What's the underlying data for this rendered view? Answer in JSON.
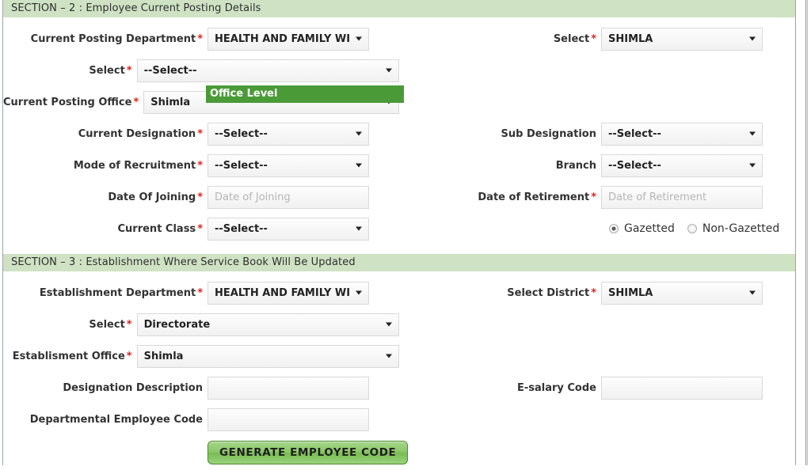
{
  "sections": [
    {
      "id": "section-2",
      "header": "SECTION – 2 : Employee Current Posting Details",
      "rows": [
        {
          "left": {
            "label": "Current Posting Department",
            "required": true,
            "type": "select",
            "value": "HEALTH AND FAMILY WI",
            "width": "narrow"
          },
          "right": {
            "label": "Select",
            "required": true,
            "type": "select",
            "value": "SHIMLA",
            "width": "narrow"
          }
        },
        {
          "left": {
            "label": "Select",
            "required": true,
            "type": "select",
            "value": "--Select--",
            "width": "wide"
          },
          "right": null
        },
        {
          "left": {
            "label": "Current Posting Office",
            "required": true,
            "type": "select",
            "value": "Shimla",
            "width": "wide"
          },
          "right": null
        },
        {
          "left": {
            "label": "Current Designation",
            "required": true,
            "type": "select",
            "value": "--Select--",
            "width": "narrow"
          },
          "right": {
            "label": "Sub Designation",
            "required": false,
            "type": "select",
            "value": "--Select--",
            "width": "narrow"
          }
        },
        {
          "left": {
            "label": "Mode of Recruitment",
            "required": true,
            "type": "select",
            "value": "--Select--",
            "width": "narrow"
          },
          "right": {
            "label": "Branch",
            "required": false,
            "type": "select",
            "value": "--Select--",
            "width": "narrow"
          }
        },
        {
          "left": {
            "label": "Date Of Joining",
            "required": true,
            "type": "text",
            "value": "",
            "placeholder": "Date of Joining",
            "width": "narrow"
          },
          "right": {
            "label": "Date of Retirement",
            "required": true,
            "type": "text",
            "value": "",
            "placeholder": "Date of Retirement",
            "width": "narrow"
          }
        },
        {
          "left": {
            "label": "Current Class",
            "required": true,
            "type": "select",
            "value": "--Select--",
            "width": "narrow"
          },
          "right": {
            "label": "",
            "required": false,
            "type": "radio"
          }
        }
      ]
    },
    {
      "id": "section-3",
      "header": "SECTION – 3 : Establishment Where Service Book Will Be Updated",
      "rows": [
        {
          "left": {
            "label": "Establishment Department",
            "required": true,
            "type": "select",
            "value": "HEALTH AND FAMILY WI",
            "width": "narrow"
          },
          "right": {
            "label": "Select District",
            "required": true,
            "type": "select",
            "value": "SHIMLA",
            "width": "narrow"
          }
        },
        {
          "left": {
            "label": "Select",
            "required": true,
            "type": "select",
            "value": "Directorate",
            "width": "wide"
          },
          "right": null
        },
        {
          "left": {
            "label": "Establisment Office",
            "required": true,
            "type": "select",
            "value": "Shimla",
            "width": "wide"
          },
          "right": null
        },
        {
          "left": {
            "label": "Designation Description",
            "required": false,
            "type": "text",
            "value": "",
            "placeholder": "",
            "width": "narrow"
          },
          "right": {
            "label": "E-salary Code",
            "required": false,
            "type": "text",
            "value": "",
            "placeholder": "",
            "width": "narrow"
          }
        },
        {
          "left": {
            "label": "Departmental Employee Code",
            "required": false,
            "type": "text",
            "value": "",
            "placeholder": "",
            "width": "narrow"
          },
          "right": null
        }
      ]
    }
  ],
  "radio_group": {
    "options": [
      {
        "label": "Gazetted",
        "checked": true
      },
      {
        "label": "Non-Gazetted",
        "checked": false
      }
    ]
  },
  "generate_button": {
    "label": "GENERATE EMPLOYEE CODE"
  },
  "open_dropdown": {
    "highlighted_option": "Office Level"
  },
  "colors": {
    "section_header_bg": "#cfe3c4",
    "dropdown_highlight": "#4a9b38",
    "required_star": "#e2231a",
    "button_green": "#88c565"
  }
}
